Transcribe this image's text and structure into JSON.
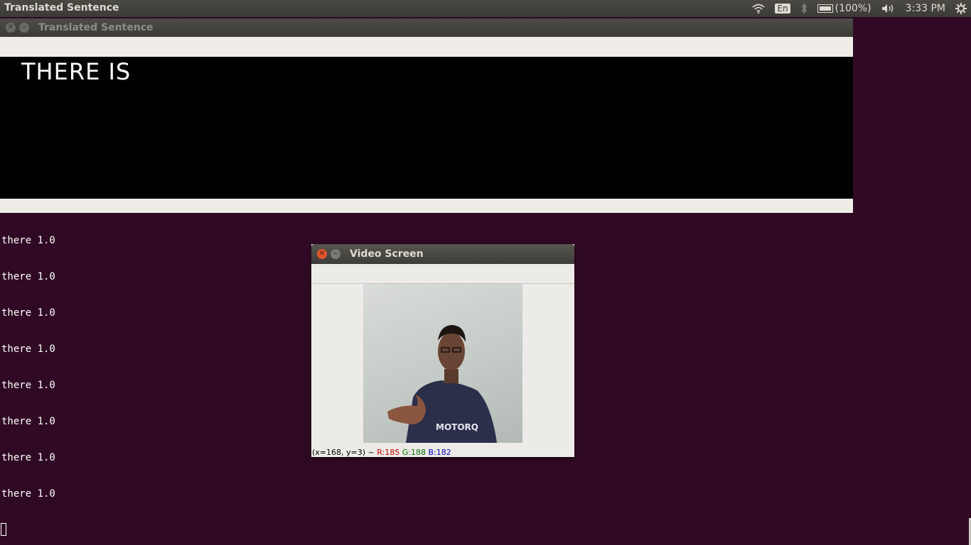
{
  "top_panel": {
    "app_title": "Translated Sentence",
    "keyboard_layout": "En",
    "battery": "(100%)",
    "clock": "3:33 PM"
  },
  "terminal": {
    "lines": [
      "there 1.0",
      "there 1.0",
      "there 1.0",
      "there 1.0",
      "there 1.0",
      "there 1.0",
      "there 1.0",
      "there 1.0"
    ]
  },
  "translated_window": {
    "title": "Translated Sentence",
    "sentence": "THERE IS"
  },
  "video_window": {
    "title": "Video Screen",
    "status": {
      "coords": "(x=168, y=3) ~",
      "r": "R:185",
      "g": "G:188",
      "b": "B:182"
    },
    "shirt_text": "MOTORQ"
  },
  "colors": {
    "desktop_bg": "#300a24",
    "panel_bg": "#3c3b37",
    "close_button": "#e2552d"
  },
  "icons": [
    "wifi-icon",
    "keyboard-layout-icon",
    "bluetooth-icon",
    "battery-icon",
    "volume-icon",
    "settings-gear-icon",
    "close-icon",
    "minimize-icon"
  ]
}
